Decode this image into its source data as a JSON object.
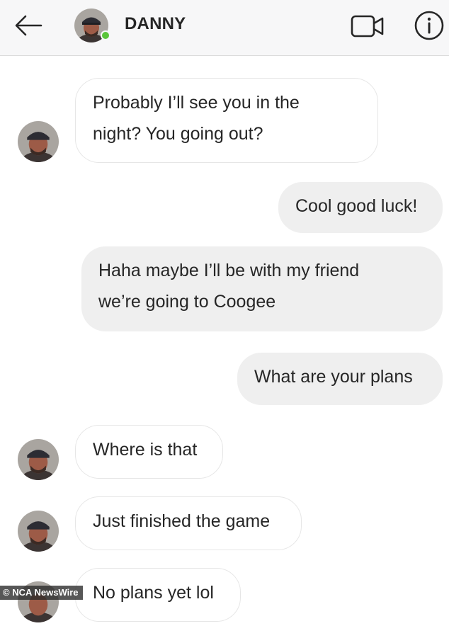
{
  "header": {
    "back_icon": "arrow-left-icon",
    "contact_name": "DANNY",
    "online_color": "#5ac53a",
    "video_icon": "video-camera-icon",
    "info_icon": "info-icon"
  },
  "messages": [
    {
      "direction": "in",
      "text": "Probably I’ll see you in the\nnight? You going out?"
    },
    {
      "direction": "out",
      "text": "Cool good luck!"
    },
    {
      "direction": "out",
      "text": "Haha maybe I’ll be with my friend\nwe’re going to Coogee"
    },
    {
      "direction": "out",
      "text": "What are your plans"
    },
    {
      "direction": "in",
      "text": "Where is that"
    },
    {
      "direction": "in",
      "text": "Just finished the game"
    },
    {
      "direction": "in",
      "text": "No plans yet lol"
    }
  ],
  "watermark": "© NCA NewsWire"
}
